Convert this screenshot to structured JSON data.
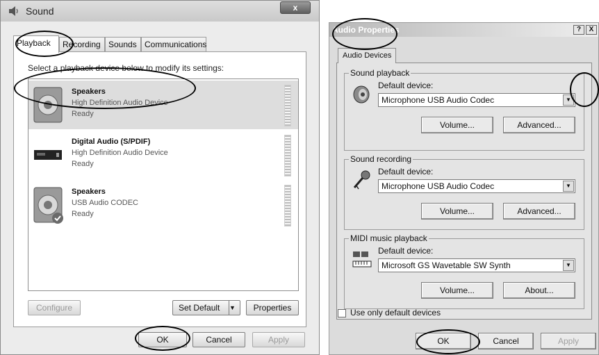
{
  "sound_dialog": {
    "title": "Sound",
    "close_label": "x",
    "tabs": [
      {
        "label": "Playback",
        "active": true
      },
      {
        "label": "Recording",
        "active": false
      },
      {
        "label": "Sounds",
        "active": false
      },
      {
        "label": "Communications",
        "active": false
      }
    ],
    "prompt": "Select a playback device below to modify its settings:",
    "devices": [
      {
        "name": "Speakers",
        "description": "High Definition Audio Device",
        "status": "Ready",
        "selected": true
      },
      {
        "name": "Digital Audio (S/PDIF)",
        "description": "High Definition Audio Device",
        "status": "Ready",
        "selected": false
      },
      {
        "name": "Speakers",
        "description": "USB Audio CODEC",
        "status": "Ready",
        "selected": false
      }
    ],
    "configure_label": "Configure",
    "set_default_label": "Set Default",
    "properties_label": "Properties",
    "ok_label": "OK",
    "cancel_label": "Cancel",
    "apply_label": "Apply"
  },
  "audio_properties": {
    "title": "Audio Properties",
    "help_label": "?",
    "close_label": "X",
    "tab_label": "Audio Devices",
    "groups": [
      {
        "legend": "Sound playback",
        "device_label": "Default device:",
        "device_value": "Microphone USB Audio Codec",
        "button1": "Volume...",
        "button2": "Advanced..."
      },
      {
        "legend": "Sound recording",
        "device_label": "Default device:",
        "device_value": "Microphone USB Audio Codec",
        "button1": "Volume...",
        "button2": "Advanced..."
      },
      {
        "legend": "MIDI music playback",
        "device_label": "Default device:",
        "device_value": "Microsoft GS Wavetable SW Synth",
        "button1": "Volume...",
        "button2": "About..."
      }
    ],
    "use_only_default_label": "Use only default devices",
    "ok_label": "OK",
    "cancel_label": "Cancel",
    "apply_label": "Apply"
  }
}
